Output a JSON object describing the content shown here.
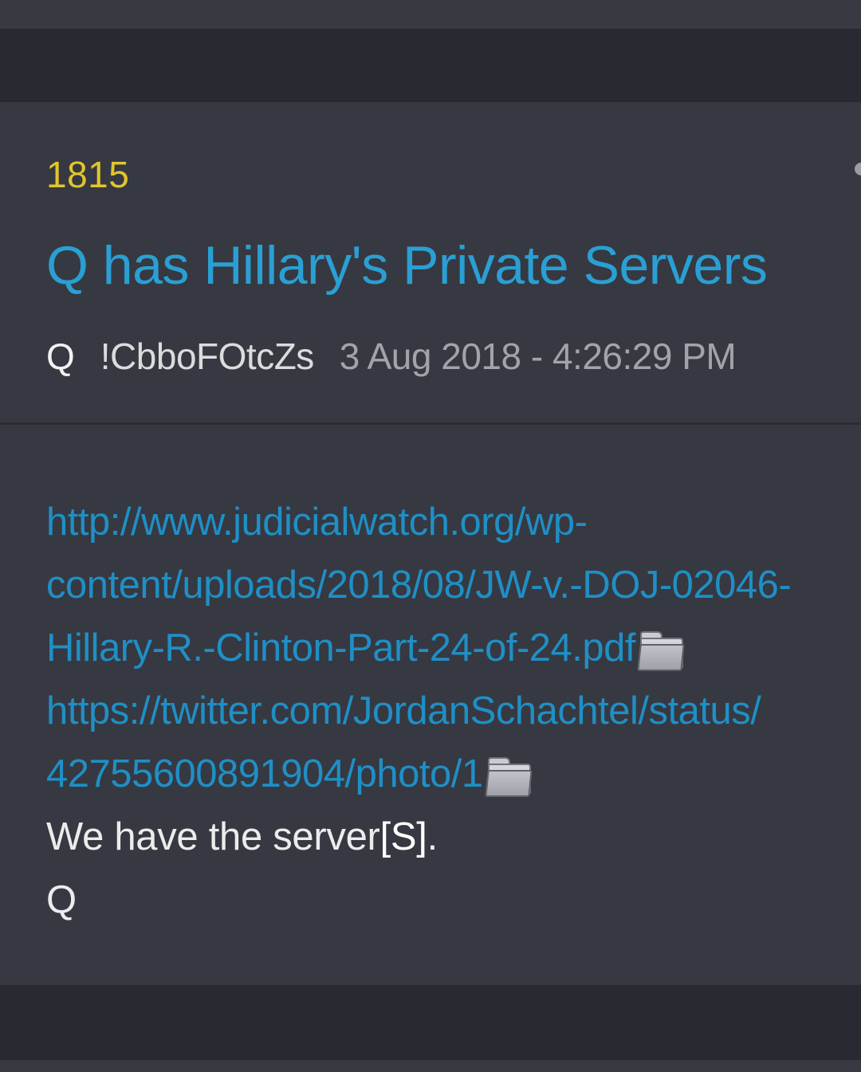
{
  "post": {
    "number": "1815",
    "title": "Q has Hillary's Private Servers",
    "author": "Q",
    "tripcode": "!CbboFOtcZs",
    "timestamp": "3 Aug 2018 - 4:26:29 PM",
    "body": {
      "link1_line1": "http://www.judicialwatch.org/wp-",
      "link1_line2": "content/uploads/2018/08/JW-v.-DOJ-02046-",
      "link1_line3": "Hillary-R.-Clinton-Part-24-of-24.pdf",
      "link2_line1": "https://twitter.com/JordanSchachtel/status/",
      "link2_line2": "42755600891904/photo/1",
      "text_line1_a": "We have the server",
      "text_line1_b": "[S]",
      "text_line1_c": ".",
      "signature": "Q"
    }
  },
  "icons": {
    "attachment": "folder-icon",
    "overflow": "menu-dot-icon"
  },
  "colors": {
    "post_number": "#e2c52c",
    "title": "#2a9fd4",
    "link": "#1f8fc6",
    "background": "#363941"
  }
}
